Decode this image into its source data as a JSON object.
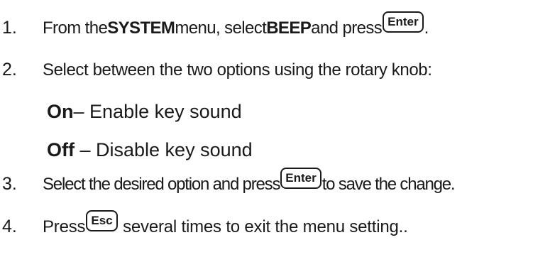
{
  "steps": [
    {
      "num": "1.",
      "t1": "From the ",
      "b1": "SYSTEM",
      "t2": " menu, select ",
      "b2": "BEEP",
      "t3": " and press",
      "key": "Enter",
      "t4": "."
    },
    {
      "num": "2.",
      "t1": "Select between the two options using the rotary knob:"
    },
    {
      "num": "3.",
      "t1": "Select the desired option and press",
      "key": "Enter",
      "t2": "to save the change."
    },
    {
      "num": "4.",
      "t1": "Press",
      "key": "Esc",
      "t2": " several times to exit the menu setting.."
    }
  ],
  "options": [
    {
      "label": "On",
      "sep": "–",
      "desc": " Enable key sound"
    },
    {
      "label": "Off",
      "sep": " – ",
      "desc": "Disable key sound"
    }
  ]
}
